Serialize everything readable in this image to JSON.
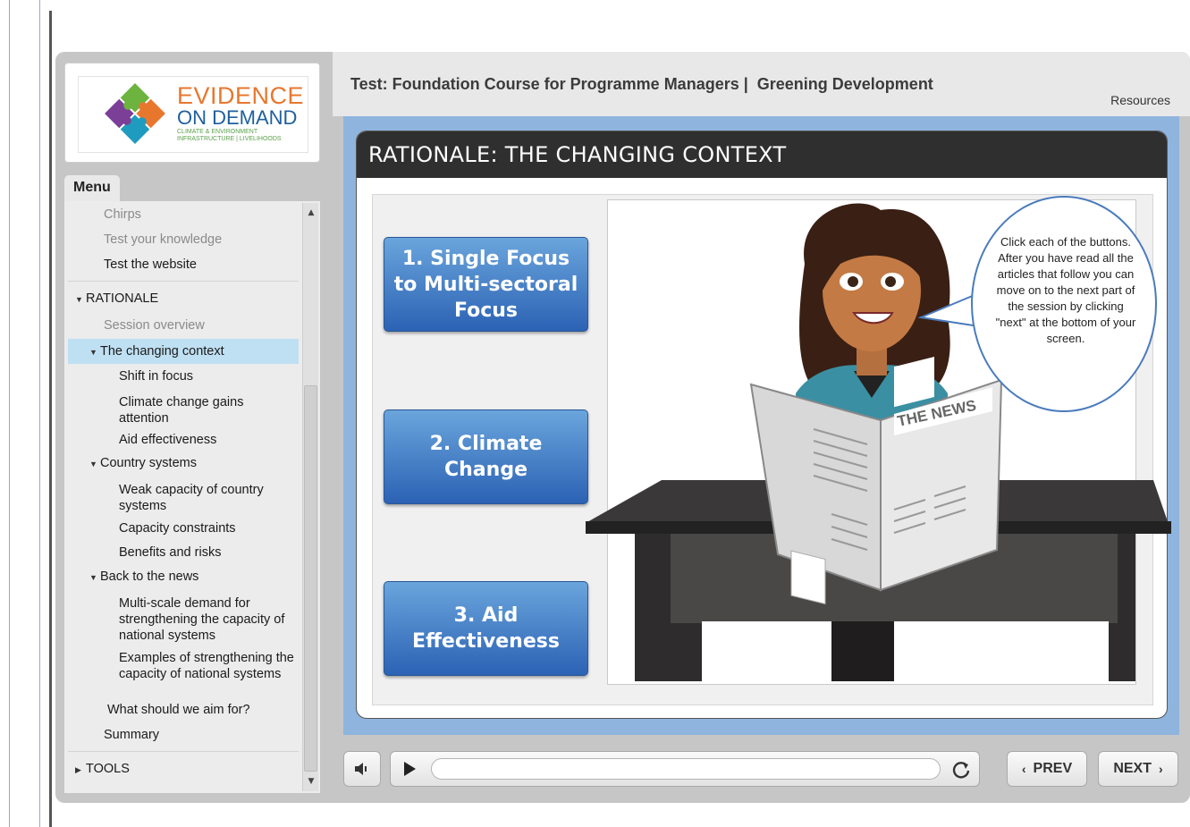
{
  "logo": {
    "line1": "EVIDENCE",
    "line2": "ON DEMAND",
    "line3": "CLIMATE & ENVIRONMENT",
    "line4": "INFRASTRUCTURE | LIVELIHOODS"
  },
  "header": {
    "course_title": "Test: Foundation Course for Programme Managers |  Greening Development",
    "resources_label": "Resources"
  },
  "menu": {
    "tab_label": "Menu",
    "items": [
      {
        "label": "Chirps"
      },
      {
        "label": "Test your knowledge"
      },
      {
        "label": "Test the website"
      },
      {
        "label": "RATIONALE"
      },
      {
        "label": "Session overview"
      },
      {
        "label": "The changing context"
      },
      {
        "label": "Shift in focus"
      },
      {
        "label": "Climate change gains attention"
      },
      {
        "label": "Aid effectiveness"
      },
      {
        "label": "Country systems"
      },
      {
        "label": "Weak capacity of country systems"
      },
      {
        "label": "Capacity constraints"
      },
      {
        "label": "Benefits and risks"
      },
      {
        "label": "Back to the news"
      },
      {
        "label": "Multi-scale demand for strengthening the capacity of national systems"
      },
      {
        "label": "Examples of strengthening the capacity of national systems"
      },
      {
        "label": "What should we aim for?"
      },
      {
        "label": "Summary"
      },
      {
        "label": "TOOLS"
      }
    ]
  },
  "slide": {
    "title": "RATIONALE: THE CHANGING CONTEXT",
    "buttons": [
      {
        "label": "1. Single Focus to Multi-sectoral Focus"
      },
      {
        "label": "2. Climate Change"
      },
      {
        "label": "3. Aid Effectiveness"
      }
    ],
    "bubble_text": "Click each of the buttons.  After you have read all the articles that follow you can move on to the next part of the session by clicking \"next\" at the bottom of your screen.",
    "newspaper_title": "THE NEWS"
  },
  "controls": {
    "prev_label": "PREV",
    "next_label": "NEXT",
    "progress": 0.0
  },
  "icons": {
    "volume": "volume-icon",
    "play": "play-icon",
    "replay": "replay-icon",
    "prev": "chevron-left-icon",
    "next": "chevron-right-icon"
  },
  "colors": {
    "button_top": "#6aa5dc",
    "button_bottom": "#2c62b4",
    "selected_menu": "#bfe0f2",
    "stage_border": "#8fb4de",
    "title_bar": "#2f2f2f",
    "logo_orange": "#e8772e",
    "logo_blue": "#1f5f9f"
  }
}
